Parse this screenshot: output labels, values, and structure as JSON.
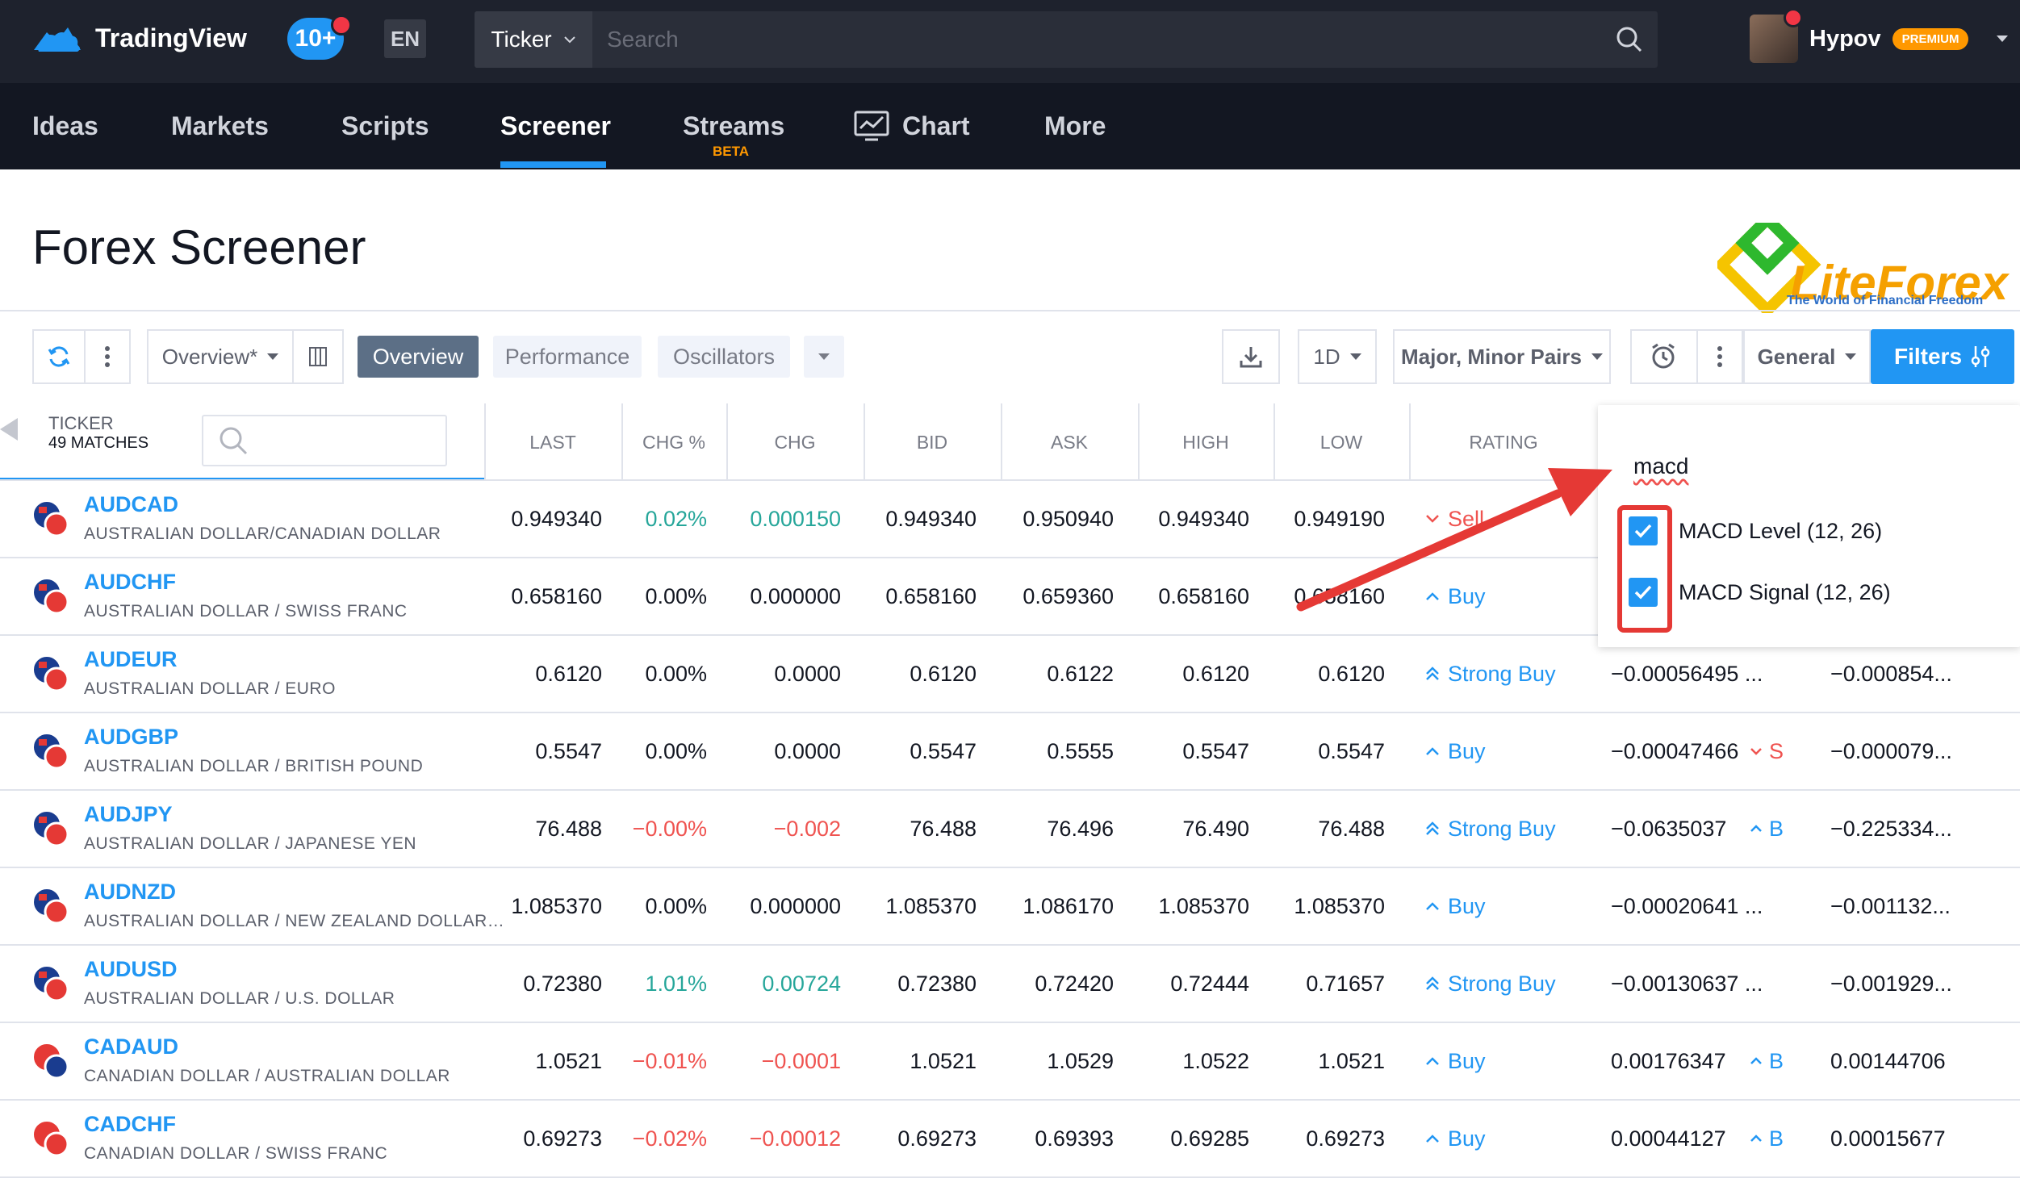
{
  "header": {
    "logo_text": "TradingView",
    "notifications": "10+",
    "language": "EN",
    "ticker_label": "Ticker",
    "search_placeholder": "Search",
    "username": "Hypov",
    "badge": "PREMIUM"
  },
  "nav": {
    "items": [
      "Ideas",
      "Markets",
      "Scripts",
      "Screener",
      "Streams",
      "Chart",
      "More"
    ],
    "beta_label": "BETA",
    "active": "Screener"
  },
  "page": {
    "title": "Forex Screener",
    "watermark_brand": "LiteForex",
    "watermark_tagline": "The World of Financial Freedom"
  },
  "toolbar": {
    "view_select": "Overview*",
    "tabs": [
      "Overview",
      "Performance",
      "Oscillators"
    ],
    "interval": "1D",
    "pairs_select": "Major, Minor Pairs",
    "group_select": "General",
    "filters_label": "Filters"
  },
  "table": {
    "ticker_header": "TICKER",
    "matches": "49 MATCHES",
    "columns": [
      "LAST",
      "CHG %",
      "CHG",
      "BID",
      "ASK",
      "HIGH",
      "LOW",
      "RATING"
    ],
    "rows": [
      {
        "symbol": "AUDCAD",
        "desc": "AUSTRALIAN DOLLAR/CANADIAN DOLLAR",
        "last": "0.949340",
        "chg_pct": "0.02%",
        "chg": "0.000150",
        "bid": "0.949340",
        "ask": "0.950940",
        "high": "0.949340",
        "low": "0.949190",
        "rating": "Sell",
        "dir": "pos",
        "rating_kind": "sell",
        "ext1": "",
        "ext2": "",
        "ext3": ""
      },
      {
        "symbol": "AUDCHF",
        "desc": "AUSTRALIAN DOLLAR / SWISS FRANC",
        "last": "0.658160",
        "chg_pct": "0.00%",
        "chg": "0.000000",
        "bid": "0.658160",
        "ask": "0.659360",
        "high": "0.658160",
        "low": "0.658160",
        "rating": "Buy",
        "dir": "zero",
        "rating_kind": "buy",
        "ext1": "",
        "ext2": "",
        "ext3": ""
      },
      {
        "symbol": "AUDEUR",
        "desc": "AUSTRALIAN DOLLAR / EURO",
        "last": "0.6120",
        "chg_pct": "0.00%",
        "chg": "0.0000",
        "bid": "0.6120",
        "ask": "0.6122",
        "high": "0.6120",
        "low": "0.6120",
        "rating": "Strong Buy",
        "dir": "zero",
        "rating_kind": "strong",
        "ext1": "−0.00056495 ...",
        "ext2": "",
        "ext3": "−0.000854..."
      },
      {
        "symbol": "AUDGBP",
        "desc": "AUSTRALIAN DOLLAR / BRITISH POUND",
        "last": "0.5547",
        "chg_pct": "0.00%",
        "chg": "0.0000",
        "bid": "0.5547",
        "ask": "0.5555",
        "high": "0.5547",
        "low": "0.5547",
        "rating": "Buy",
        "dir": "zero",
        "rating_kind": "buy",
        "ext1": "−0.00047466",
        "ext2": "S",
        "ext3": "−0.000079..."
      },
      {
        "symbol": "AUDJPY",
        "desc": "AUSTRALIAN DOLLAR / JAPANESE YEN",
        "last": "76.488",
        "chg_pct": "−0.00%",
        "chg": "−0.002",
        "bid": "76.488",
        "ask": "76.496",
        "high": "76.490",
        "low": "76.488",
        "rating": "Strong Buy",
        "dir": "neg",
        "rating_kind": "strong",
        "ext1": "−0.0635037",
        "ext2": "B",
        "ext3": "−0.225334..."
      },
      {
        "symbol": "AUDNZD",
        "desc": "AUSTRALIAN DOLLAR / NEW ZEALAND DOLLAR…",
        "last": "1.085370",
        "chg_pct": "0.00%",
        "chg": "0.000000",
        "bid": "1.085370",
        "ask": "1.086170",
        "high": "1.085370",
        "low": "1.085370",
        "rating": "Buy",
        "dir": "zero",
        "rating_kind": "buy",
        "ext1": "−0.00020641 ...",
        "ext2": "",
        "ext3": "−0.001132..."
      },
      {
        "symbol": "AUDUSD",
        "desc": "AUSTRALIAN DOLLAR / U.S. DOLLAR",
        "last": "0.72380",
        "chg_pct": "1.01%",
        "chg": "0.00724",
        "bid": "0.72380",
        "ask": "0.72420",
        "high": "0.72444",
        "low": "0.71657",
        "rating": "Strong Buy",
        "dir": "pos",
        "rating_kind": "strong",
        "ext1": "−0.00130637 ...",
        "ext2": "",
        "ext3": "−0.001929..."
      },
      {
        "symbol": "CADAUD",
        "desc": "CANADIAN DOLLAR / AUSTRALIAN DOLLAR",
        "last": "1.0521",
        "chg_pct": "−0.01%",
        "chg": "−0.0001",
        "bid": "1.0521",
        "ask": "1.0529",
        "high": "1.0522",
        "low": "1.0521",
        "rating": "Buy",
        "dir": "neg",
        "rating_kind": "buy",
        "ext1": "0.00176347",
        "ext2": "B",
        "ext3": "0.00144706"
      },
      {
        "symbol": "CADCHF",
        "desc": "CANADIAN DOLLAR / SWISS FRANC",
        "last": "0.69273",
        "chg_pct": "−0.02%",
        "chg": "−0.00012",
        "bid": "0.69273",
        "ask": "0.69393",
        "high": "0.69285",
        "low": "0.69273",
        "rating": "Buy",
        "dir": "neg",
        "rating_kind": "buy",
        "ext1": "0.00044127",
        "ext2": "B",
        "ext3": "0.00015677"
      }
    ]
  },
  "column_filter": {
    "query": "macd",
    "options": [
      {
        "label": "MACD Level (12, 26)",
        "checked": true
      },
      {
        "label": "MACD Signal (12, 26)",
        "checked": true
      }
    ]
  },
  "colors": {
    "accent": "#2196f3",
    "positive": "#26a69a",
    "negative": "#ef5350",
    "annotation": "#e53935",
    "premium": "#ff9800"
  }
}
